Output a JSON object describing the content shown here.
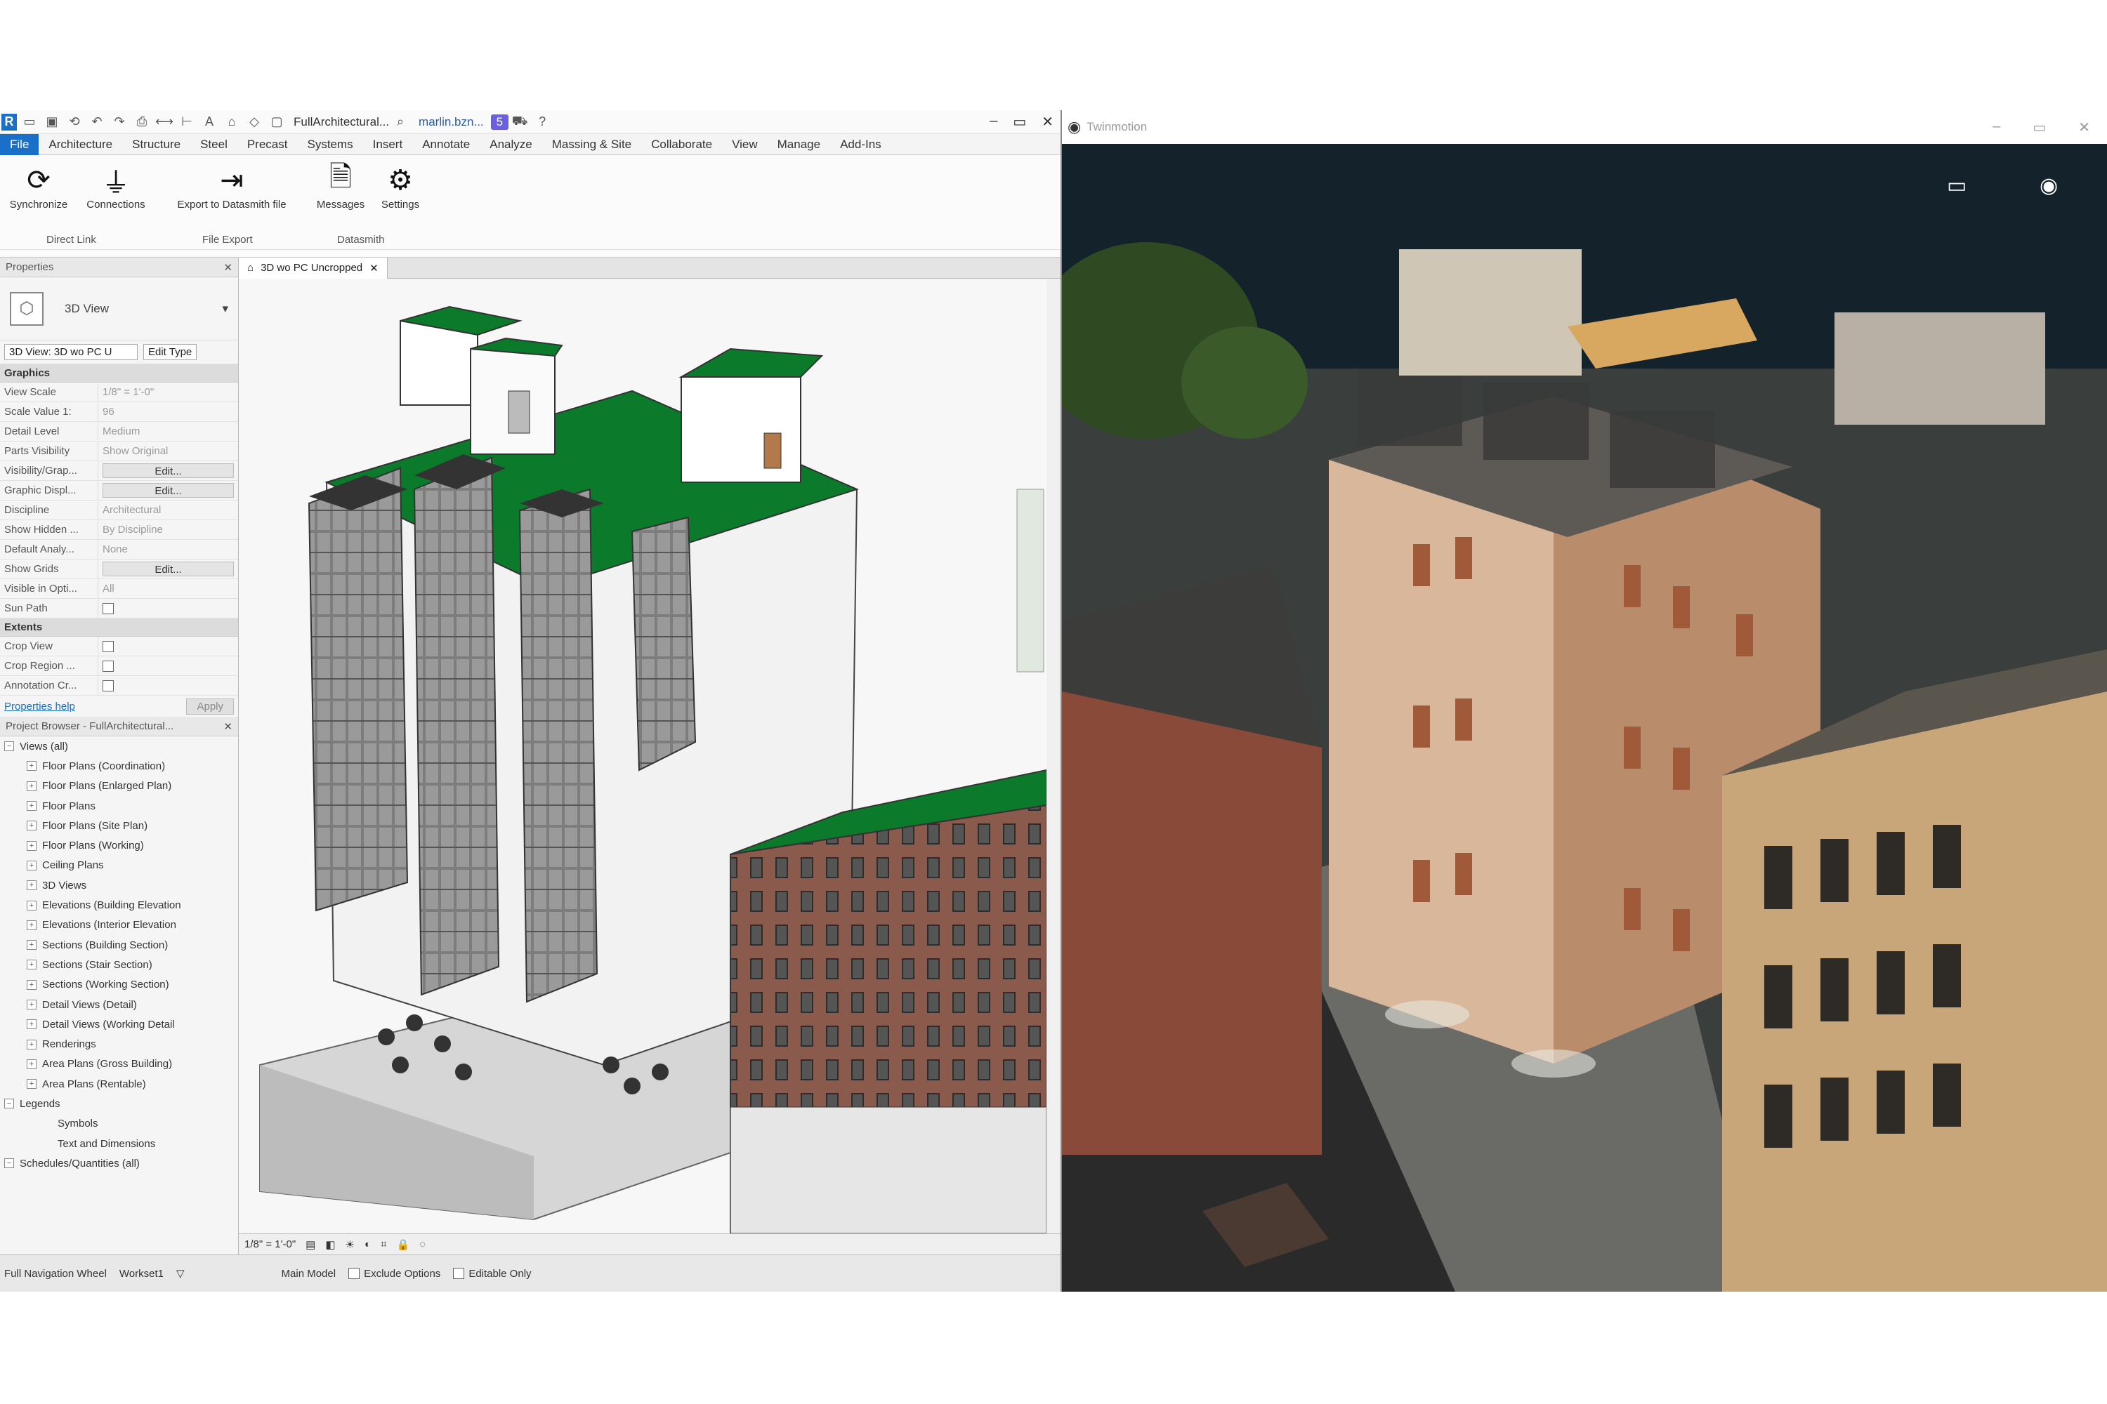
{
  "revit": {
    "doc_title": "FullArchitectural...",
    "user": "marlin.bzn...",
    "badge": "5",
    "tabs": [
      "File",
      "Architecture",
      "Structure",
      "Steel",
      "Precast",
      "Systems",
      "Insert",
      "Annotate",
      "Analyze",
      "Massing & Site",
      "Collaborate",
      "View",
      "Manage",
      "Add-Ins"
    ],
    "ribbon": {
      "synchronize": "Synchronize",
      "connections": "Connections",
      "export": "Export to Datasmith file",
      "messages": "Messages",
      "settings": "Settings",
      "panel_direct": "Direct Link",
      "panel_file": "File Export",
      "panel_datasmith": "Datasmith"
    },
    "properties": {
      "title": "Properties",
      "type": "3D View",
      "filter": "3D View: 3D wo PC U",
      "edit_type": "Edit Type",
      "group_graphics": "Graphics",
      "group_extents": "Extents",
      "rows": [
        {
          "k": "View Scale",
          "v": "1/8\" = 1'-0\""
        },
        {
          "k": "Scale Value 1:",
          "v": "96"
        },
        {
          "k": "Detail Level",
          "v": "Medium"
        },
        {
          "k": "Parts Visibility",
          "v": "Show Original"
        },
        {
          "k": "Visibility/Grap...",
          "v": "Edit..."
        },
        {
          "k": "Graphic Displ...",
          "v": "Edit..."
        },
        {
          "k": "Discipline",
          "v": "Architectural"
        },
        {
          "k": "Show Hidden ...",
          "v": "By Discipline"
        },
        {
          "k": "Default Analy...",
          "v": "None"
        },
        {
          "k": "Show Grids",
          "v": "Edit..."
        },
        {
          "k": "Visible in Opti...",
          "v": "All"
        },
        {
          "k": "Sun Path",
          "v": ""
        }
      ],
      "extents": [
        {
          "k": "Crop View",
          "v": ""
        },
        {
          "k": "Crop Region ...",
          "v": ""
        },
        {
          "k": "Annotation Cr...",
          "v": ""
        }
      ],
      "help": "Properties help",
      "apply": "Apply"
    },
    "browser": {
      "title": "Project Browser - FullArchitectural...",
      "nodes": [
        {
          "label": "Views (all)",
          "lvl": 1
        },
        {
          "label": "Floor Plans (Coordination)",
          "lvl": 2
        },
        {
          "label": "Floor Plans (Enlarged Plan)",
          "lvl": 2
        },
        {
          "label": "Floor Plans",
          "lvl": 2
        },
        {
          "label": "Floor Plans (Site Plan)",
          "lvl": 2
        },
        {
          "label": "Floor Plans (Working)",
          "lvl": 2
        },
        {
          "label": "Ceiling Plans",
          "lvl": 2
        },
        {
          "label": "3D Views",
          "lvl": 2
        },
        {
          "label": "Elevations (Building Elevation",
          "lvl": 2
        },
        {
          "label": "Elevations (Interior Elevation",
          "lvl": 2
        },
        {
          "label": "Sections (Building Section)",
          "lvl": 2
        },
        {
          "label": "Sections (Stair Section)",
          "lvl": 2
        },
        {
          "label": "Sections (Working Section)",
          "lvl": 2
        },
        {
          "label": "Detail Views (Detail)",
          "lvl": 2
        },
        {
          "label": "Detail Views (Working Detail",
          "lvl": 2
        },
        {
          "label": "Renderings",
          "lvl": 2
        },
        {
          "label": "Area Plans (Gross Building)",
          "lvl": 2
        },
        {
          "label": "Area Plans (Rentable)",
          "lvl": 2
        },
        {
          "label": "Legends",
          "lvl": 1
        },
        {
          "label": "Symbols",
          "lvl": 3
        },
        {
          "label": "Text and Dimensions",
          "lvl": 3
        },
        {
          "label": "Schedules/Quantities (all)",
          "lvl": 1
        }
      ]
    },
    "view_tab": "3D wo PC Uncropped",
    "view_scale": "1/8\" = 1'-0\"",
    "status": {
      "nav": "Full Navigation Wheel",
      "workset": "Workset1",
      "model": "Main Model",
      "exclude": "Exclude Options",
      "editable": "Editable Only"
    }
  },
  "twinmotion": {
    "title": "Twinmotion"
  }
}
